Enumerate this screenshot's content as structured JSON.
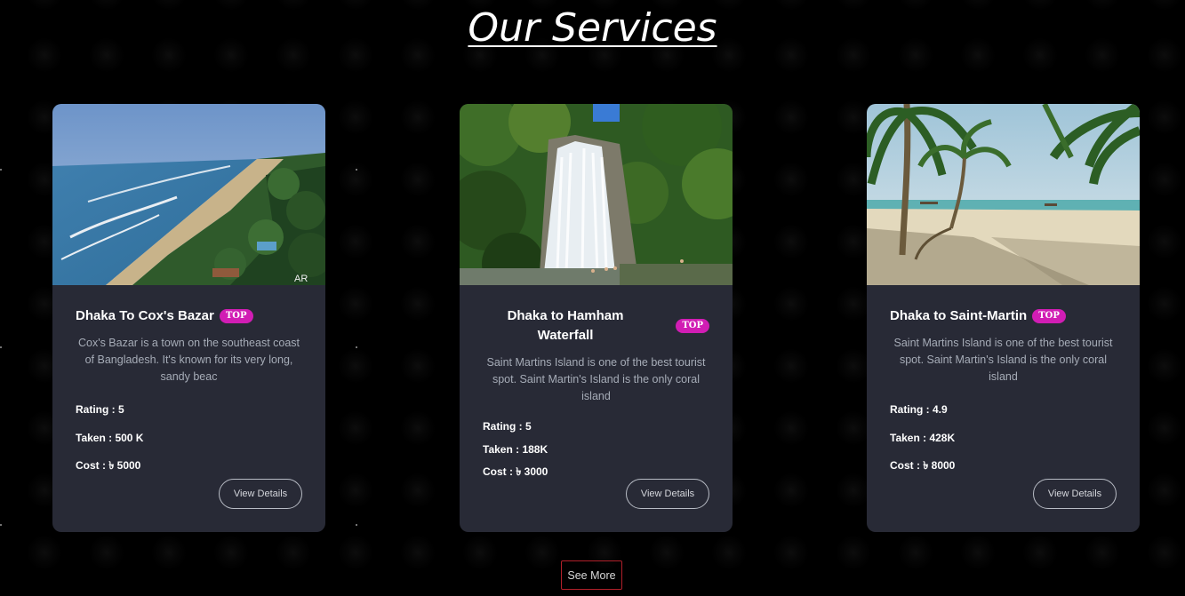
{
  "section": {
    "title": "Our Services"
  },
  "cards": [
    {
      "title": "Dhaka To Cox's Bazar",
      "badge": "TOP",
      "description": "Cox's Bazar is a town on the southeast coast of Bangladesh. It's known for its very long, sandy beac",
      "rating": "Rating : 5",
      "taken": "Taken : 500 K",
      "cost": "Cost : ৳ 5000",
      "button": "View Details",
      "image_watermark": "AR"
    },
    {
      "title": "Dhaka to Hamham Waterfall",
      "badge": "TOP",
      "description": "Saint Martins Island is one of the best tourist spot. Saint Martin's Island is the only coral island",
      "rating": "Rating : 5",
      "taken": "Taken : 188K",
      "cost": "Cost : ৳ 3000",
      "button": "View Details"
    },
    {
      "title": "Dhaka to Saint-Martin",
      "badge": "TOP",
      "description": "Saint Martins Island is one of the best tourist spot. Saint Martin's Island is the only coral island",
      "rating": "Rating : 4.9",
      "taken": "Taken : 428K",
      "cost": "Cost : ৳ 8000",
      "button": "View Details"
    }
  ],
  "see_more": "See More",
  "colors": {
    "background": "#000000",
    "card": "#282a36",
    "badge": "#d11db4",
    "see_more_border": "#b0202a"
  }
}
